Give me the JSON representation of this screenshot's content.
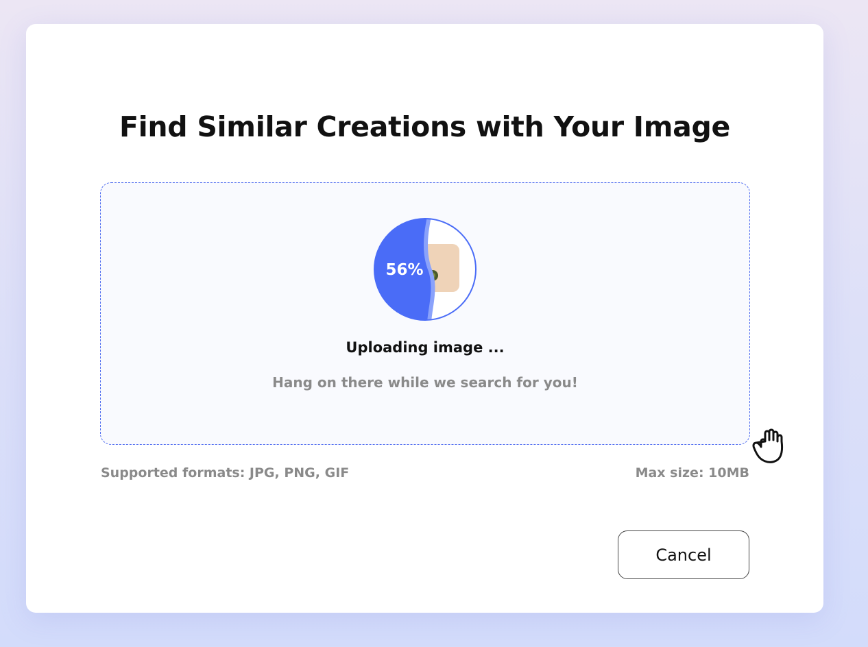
{
  "dialog": {
    "title": "Find Similar Creations with Your Image"
  },
  "upload": {
    "progress_percent": 56,
    "progress_label": "56%",
    "status_title": "Uploading image ...",
    "status_subtitle": "Hang on there while we search for you!"
  },
  "hints": {
    "formats": "Supported formats: JPG, PNG, GIF",
    "max_size": "Max size: 10MB"
  },
  "actions": {
    "cancel_label": "Cancel"
  },
  "colors": {
    "accent": "#4a6cf7",
    "thumbnail": "#efd3b8",
    "muted_text": "#8a8a8a"
  },
  "icons": {
    "cursor": "grab-hand-icon"
  }
}
